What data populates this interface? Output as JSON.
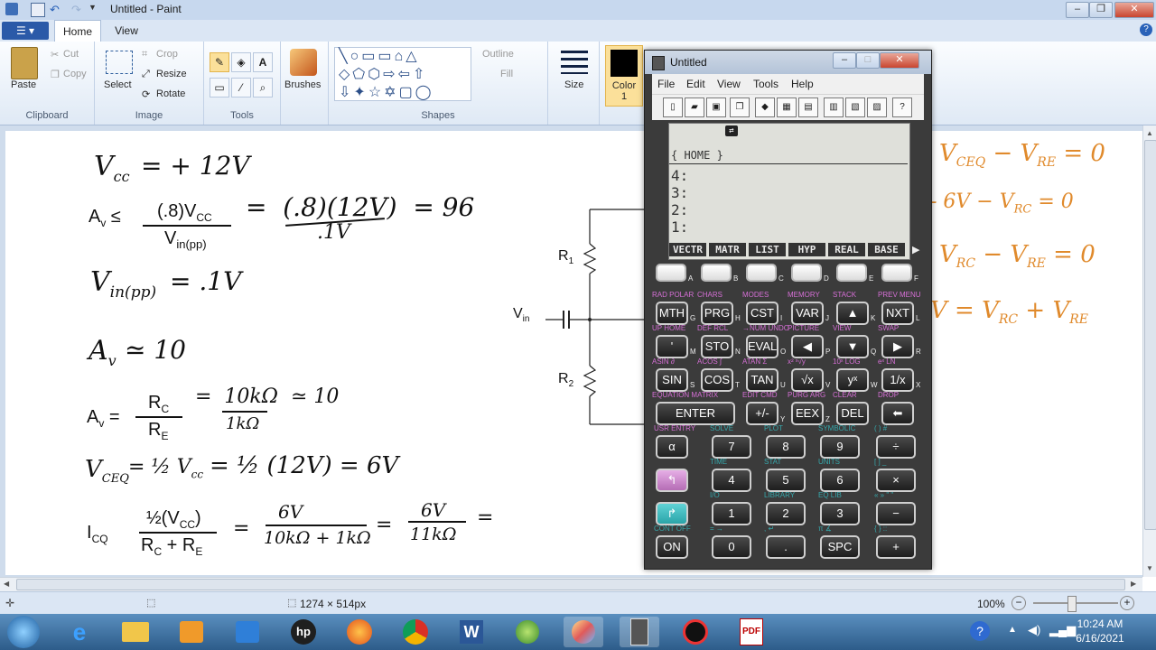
{
  "window": {
    "title": "Untitled - Paint"
  },
  "ribbon": {
    "tabs": [
      "Home",
      "View"
    ],
    "clipboard": {
      "paste": "Paste",
      "cut": "Cut",
      "copy": "Copy",
      "label": "Clipboard"
    },
    "image": {
      "select": "Select",
      "crop": "Crop",
      "resize": "Resize",
      "rotate": "Rotate",
      "label": "Image"
    },
    "tools": {
      "label": "Tools"
    },
    "brushes": {
      "label": "Brushes"
    },
    "shapes": {
      "outline": "Outline",
      "fill": "Fill",
      "label": "Shapes"
    },
    "size": {
      "label": "Size"
    },
    "color": {
      "label": "Color\n1",
      "value": "#000000"
    }
  },
  "canvas": {
    "lines": {
      "vcc": "V",
      "vcc_sub": "cc",
      "vcc_val": "= + 12V",
      "av_leq": "A",
      "av_sub": "v",
      "leq": "≤",
      "frac1_num": "(.8)V",
      "frac1_num_sub": "CC",
      "frac1_den": "V",
      "frac1_den_sub": "in(pp)",
      "eq_hw1": "=  (.8)(12V)  = 96",
      "eq_hw1_den": ".1V",
      "vin": "V",
      "vin_sub": "in(pp)",
      "vin_val": "= .1V",
      "av2": "A",
      "av2_sub": "v",
      "av2_val": "≃ 10",
      "av3": "A",
      "av3_sub": "v",
      "av3_eq": "=",
      "rc": "R",
      "rc_sub": "C",
      "re": "R",
      "re_sub": "E",
      "av3_hw": "=  10kΩ  ≃ 10",
      "av3_hw_den": "1kΩ",
      "vceq": "V",
      "vceq_sub": "CEQ",
      "vceq_hw": "= ½ V",
      "vceq_hw_sub": "cc",
      "vceq_hw2": "= ½ (12V) = 6V",
      "icq": "I",
      "icq_sub": "CQ",
      "icq_eq": "=",
      "icq_num": "½(V",
      "icq_num_sub": "CC",
      "icq_num_end": ")",
      "icq_den1": "R",
      "icq_den1_sub": "C",
      "icq_den_plus": " + R",
      "icq_den2_sub": "E",
      "icq_hw1_num": "6V",
      "icq_hw1_den": "10kΩ + 1kΩ",
      "icq_hw2_num": "6V",
      "icq_hw2_den": "11kΩ",
      "icq_hw_eq": "=",
      "icq_hw_eq2": "=",
      "r1": "R",
      "r1_sub": "1",
      "r2": "R",
      "r2_sub": "2",
      "vin_circ": "V",
      "vin_circ_sub": "in",
      "o1": "V",
      "o1_sub": "CEQ",
      "o1_rest": "− V",
      "o1_sub2": "RE",
      "o1_end": "= 0",
      "o2": "- 6V − V",
      "o2_sub": "RC",
      "o2_end": "= 0",
      "o3": "V",
      "o3_sub": "RC",
      "o3_rest": "− V",
      "o3_sub2": "RE",
      "o3_end": "= 0",
      "o4": "V = V",
      "o4_sub": "RC",
      "o4_rest": "+ V",
      "o4_sub2": "RE"
    }
  },
  "status": {
    "dimensions": "1274 × 514px",
    "zoom": "100%"
  },
  "taskbar": {
    "time": "10:24 AM",
    "date": "6/16/2021"
  },
  "emulator": {
    "title": "Untitled",
    "menu": [
      "File",
      "Edit",
      "View",
      "Tools",
      "Help"
    ],
    "screen": {
      "header": "{ HOME }",
      "stack": [
        "4:",
        "3:",
        "2:",
        "1:"
      ],
      "softkeys": [
        "VECTR",
        "MATR",
        "LIST",
        "HYP",
        "REAL",
        "BASE"
      ]
    },
    "keys": {
      "row1_letters": [
        "A",
        "B",
        "C",
        "D",
        "E",
        "F"
      ],
      "row2_top": [
        "RAD POLAR",
        "CHARS",
        "MODES",
        "MEMORY",
        "STACK",
        "PREV MENU"
      ],
      "row2": [
        "MTH",
        "PRG",
        "CST",
        "VAR",
        "▲",
        "NXT"
      ],
      "row2_letters": [
        "G",
        "H",
        "I",
        "J",
        "K",
        "L"
      ],
      "row3_top": [
        "UP  HOME",
        "DEF  RCL",
        "→NUM UNDO",
        "PICTURE",
        "VIEW",
        "SWAP"
      ],
      "row3": [
        "'",
        "STO",
        "EVAL",
        "◀",
        "▼",
        "▶"
      ],
      "row3_letters": [
        "M",
        "N",
        "O",
        "P",
        "Q",
        "R"
      ],
      "row4_top": [
        "ASIN  ∂",
        "ACOS  ∫",
        "ATAN  Σ",
        "x²  ˣ√y",
        "10ˣ  LOG",
        "eˣ  LN"
      ],
      "row4": [
        "SIN",
        "COS",
        "TAN",
        "√x",
        "yˣ",
        "1/x"
      ],
      "row4_letters": [
        "S",
        "T",
        "U",
        "V",
        "W",
        "X"
      ],
      "row5_top": [
        "EQUATION  MATRIX",
        "EDIT  CMD",
        "PURG  ARG",
        "CLEAR",
        "DROP"
      ],
      "row5": [
        "ENTER",
        "+/-",
        "EEX",
        "DEL",
        "⬅"
      ],
      "row5_letters": [
        "Y",
        "Z"
      ],
      "row6_top": [
        "USR  ENTRY",
        "SOLVE",
        "PLOT",
        "SYMBOLIC",
        "( )  #"
      ],
      "row6": [
        "α",
        "7",
        "8",
        "9",
        "÷"
      ],
      "row7_top": [
        "TIME",
        "STAT",
        "UNITS",
        "[ ]  _"
      ],
      "row7": [
        "↰",
        "4",
        "5",
        "6",
        "×"
      ],
      "row8_top": [
        "I/O",
        "LIBRARY",
        "EQ LIB",
        "« »  \" \""
      ],
      "row8": [
        "↱",
        "1",
        "2",
        "3",
        "−"
      ],
      "row9_top": [
        "CONT  OFF",
        "=  →",
        ",  ↵",
        "π  ∡",
        "{ }  ::"
      ],
      "row9": [
        "ON",
        "0",
        ".",
        "SPC",
        "+"
      ]
    }
  }
}
